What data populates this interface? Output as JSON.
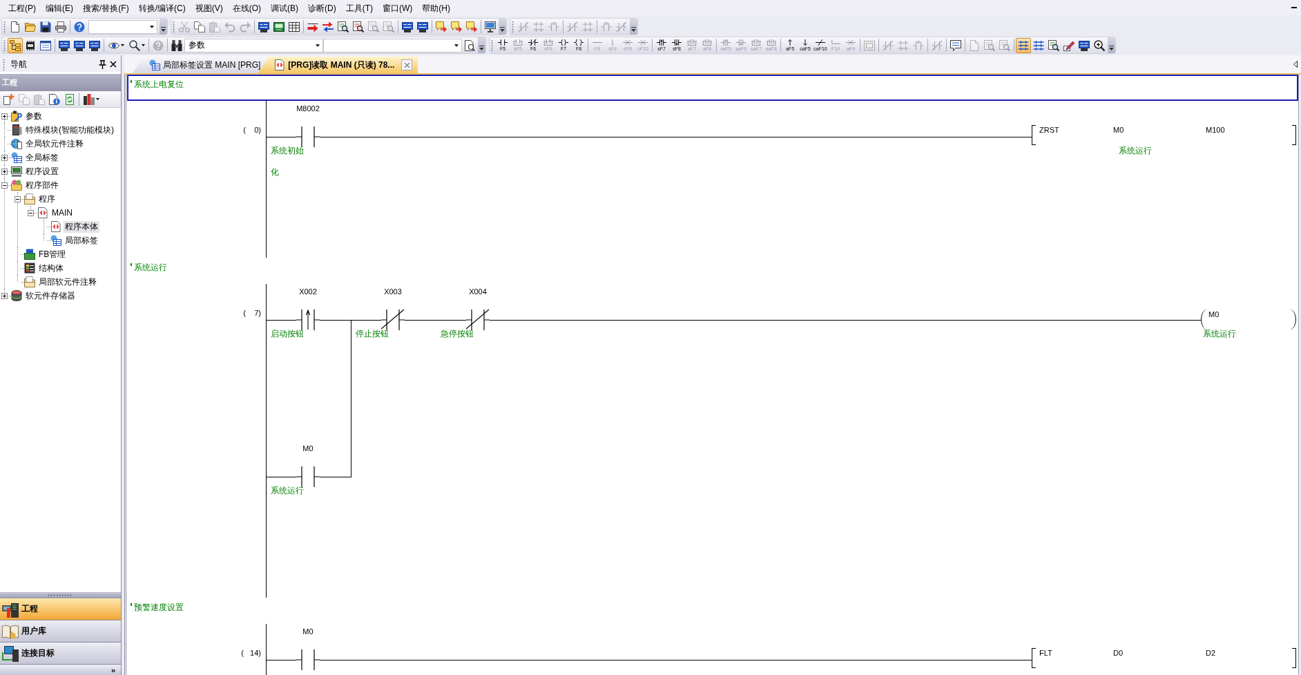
{
  "menu_bar": {
    "items": [
      "工程(P)",
      "编辑(E)",
      "搜索/替换(F)",
      "转换/编译(C)",
      "视图(V)",
      "在线(O)",
      "调试(B)",
      "诊断(D)",
      "工具(T)",
      "窗口(W)",
      "帮助(H)"
    ]
  },
  "toolbar_rows": [
    [
      {
        "items": [
          {
            "kind": "button",
            "disabled": false,
            "on": false
          },
          {
            "kind": "button",
            "disabled": false,
            "on": false
          },
          {
            "kind": "button",
            "disabled": false,
            "on": false
          },
          {
            "kind": "button",
            "disabled": false,
            "on": false
          },
          {
            "kind": "separator"
          },
          {
            "kind": "button",
            "disabled": false,
            "on": false
          },
          {
            "kind": "combo"
          }
        ]
      },
      {
        "items": [
          {
            "kind": "button",
            "disabled": true,
            "on": false
          },
          {
            "kind": "button",
            "disabled": false,
            "on": false
          },
          {
            "kind": "button",
            "disabled": true,
            "on": false
          },
          {
            "kind": "button",
            "disabled": true,
            "on": false
          },
          {
            "kind": "button",
            "disabled": true,
            "on": false
          },
          {
            "kind": "separator"
          },
          {
            "kind": "button",
            "disabled": false,
            "on": false
          },
          {
            "kind": "button",
            "disabled": false,
            "on": false
          },
          {
            "kind": "button",
            "disabled": false,
            "on": false
          },
          {
            "kind": "separator"
          },
          {
            "kind": "button",
            "disabled": false,
            "on": false
          },
          {
            "kind": "button",
            "disabled": false,
            "on": false
          },
          {
            "kind": "button",
            "disabled": false,
            "on": false
          },
          {
            "kind": "button",
            "disabled": false,
            "on": false
          },
          {
            "kind": "button",
            "disabled": true,
            "on": false
          },
          {
            "kind": "button",
            "disabled": true,
            "on": false
          },
          {
            "kind": "separator"
          },
          {
            "kind": "button",
            "disabled": false,
            "on": false
          },
          {
            "kind": "button",
            "disabled": false,
            "on": false
          },
          {
            "kind": "separator"
          },
          {
            "kind": "button",
            "disabled": false,
            "on": false
          },
          {
            "kind": "button",
            "disabled": false,
            "on": false
          },
          {
            "kind": "button",
            "disabled": false,
            "on": false
          },
          {
            "kind": "separator"
          },
          {
            "kind": "button",
            "disabled": false,
            "on": false
          }
        ]
      },
      {
        "items": [
          {
            "kind": "button",
            "disabled": true,
            "on": false
          },
          {
            "kind": "button",
            "disabled": true,
            "on": false
          },
          {
            "kind": "button",
            "disabled": true,
            "on": false
          },
          {
            "kind": "separator"
          },
          {
            "kind": "button",
            "disabled": true,
            "on": false
          },
          {
            "kind": "button",
            "disabled": true,
            "on": false
          },
          {
            "kind": "separator"
          },
          {
            "kind": "button",
            "disabled": true,
            "on": false
          },
          {
            "kind": "button",
            "disabled": true,
            "on": false
          }
        ]
      }
    ],
    [
      {
        "items": [
          {
            "kind": "button",
            "disabled": false,
            "on": true
          },
          {
            "kind": "button",
            "disabled": false,
            "on": false
          },
          {
            "kind": "button",
            "disabled": false,
            "on": false
          },
          {
            "kind": "separator"
          },
          {
            "kind": "button",
            "disabled": false,
            "on": false
          },
          {
            "kind": "button",
            "disabled": false,
            "on": false
          },
          {
            "kind": "button",
            "disabled": false,
            "on": false
          },
          {
            "kind": "separator"
          },
          {
            "kind": "menu-button",
            "disabled": false,
            "on": false
          },
          {
            "kind": "menu-button",
            "disabled": false,
            "on": false
          },
          {
            "kind": "separator"
          },
          {
            "kind": "button",
            "disabled": true,
            "on": false
          },
          {
            "kind": "separator"
          },
          {
            "kind": "button",
            "disabled": false,
            "on": false
          },
          {
            "kind": "combo",
            "value": "参数"
          },
          {
            "kind": "combo"
          },
          {
            "kind": "button",
            "disabled": false,
            "on": false
          }
        ]
      },
      {
        "items": [
          {
            "kind": "fkey",
            "label": "F5",
            "disabled": false,
            "on": false
          },
          {
            "kind": "fkey",
            "label": "sF5",
            "disabled": true,
            "on": false
          },
          {
            "kind": "fkey",
            "label": "F6",
            "disabled": false,
            "on": false
          },
          {
            "kind": "fkey",
            "label": "sF6",
            "disabled": true,
            "on": false
          },
          {
            "kind": "fkey",
            "label": "F7",
            "disabled": false,
            "on": false
          },
          {
            "kind": "fkey",
            "label": "F8",
            "disabled": false,
            "on": false
          },
          {
            "kind": "separator"
          },
          {
            "kind": "fkey",
            "label": "F9",
            "disabled": true,
            "on": false
          },
          {
            "kind": "fkey",
            "label": "sF9",
            "disabled": true,
            "on": false
          },
          {
            "kind": "fkey",
            "label": "cF9",
            "disabled": true,
            "on": false
          },
          {
            "kind": "fkey",
            "label": "cF10",
            "disabled": true,
            "on": false
          },
          {
            "kind": "separator"
          },
          {
            "kind": "fkey",
            "label": "sF7",
            "disabled": false,
            "on": false
          },
          {
            "kind": "fkey",
            "label": "sF8",
            "disabled": false,
            "on": false
          },
          {
            "kind": "fkey",
            "label": "aF7",
            "disabled": true,
            "on": false
          },
          {
            "kind": "fkey",
            "label": "aF8",
            "disabled": true,
            "on": false
          },
          {
            "kind": "separator"
          },
          {
            "kind": "fkey",
            "label": "saF5",
            "disabled": true,
            "on": false
          },
          {
            "kind": "fkey",
            "label": "saF6",
            "disabled": true,
            "on": false
          },
          {
            "kind": "fkey",
            "label": "saF7",
            "disabled": true,
            "on": false
          },
          {
            "kind": "fkey",
            "label": "saF8",
            "disabled": true,
            "on": false
          },
          {
            "kind": "separator"
          },
          {
            "kind": "fkey",
            "label": "aF5",
            "disabled": false,
            "on": false
          },
          {
            "kind": "fkey",
            "label": "caF5",
            "disabled": false,
            "on": false
          },
          {
            "kind": "fkey",
            "label": "caF10",
            "disabled": false,
            "on": false
          },
          {
            "kind": "fkey",
            "label": "F10",
            "disabled": true,
            "on": false
          },
          {
            "kind": "fkey",
            "label": "aF9",
            "disabled": true,
            "on": false
          },
          {
            "kind": "separator"
          },
          {
            "kind": "button",
            "disabled": true,
            "on": false
          },
          {
            "kind": "separator"
          },
          {
            "kind": "button",
            "disabled": true,
            "on": false
          },
          {
            "kind": "button",
            "disabled": true,
            "on": false
          },
          {
            "kind": "button",
            "disabled": true,
            "on": false
          },
          {
            "kind": "separator"
          },
          {
            "kind": "button",
            "disabled": true,
            "on": false
          },
          {
            "kind": "separator"
          },
          {
            "kind": "button",
            "disabled": false,
            "on": false
          },
          {
            "kind": "separator"
          },
          {
            "kind": "button",
            "disabled": true,
            "on": false
          },
          {
            "kind": "button",
            "disabled": true,
            "on": false
          },
          {
            "kind": "button",
            "disabled": true,
            "on": false
          },
          {
            "kind": "separator"
          },
          {
            "kind": "button",
            "disabled": false,
            "on": true
          },
          {
            "kind": "button",
            "disabled": false,
            "on": false
          },
          {
            "kind": "button",
            "disabled": false,
            "on": false
          },
          {
            "kind": "button",
            "disabled": false,
            "on": false
          },
          {
            "kind": "button",
            "disabled": false,
            "on": false
          },
          {
            "kind": "button",
            "disabled": false,
            "on": false
          }
        ]
      }
    ]
  ],
  "navigation": {
    "caption": "导航",
    "section": "工程",
    "toolbar": [
      {
        "kind": "button",
        "disabled": false,
        "on": false
      },
      {
        "kind": "button",
        "disabled": true,
        "on": false
      },
      {
        "kind": "button",
        "disabled": true,
        "on": false
      },
      {
        "kind": "button",
        "disabled": false,
        "on": false
      },
      {
        "kind": "button",
        "disabled": false,
        "on": false
      },
      {
        "kind": "separator"
      },
      {
        "kind": "menu-button",
        "disabled": false,
        "on": false
      }
    ],
    "tree": [
      {
        "label": "参数",
        "expanded": false,
        "selected": false
      },
      {
        "label": "特殊模块(智能功能模块)",
        "selected": false
      },
      {
        "label": "全局软元件注释",
        "selected": false
      },
      {
        "label": "全局标签",
        "expanded": false,
        "selected": false
      },
      {
        "label": "程序设置",
        "expanded": false,
        "selected": false
      },
      {
        "label": "程序部件",
        "expanded": true,
        "selected": false,
        "children": [
          {
            "label": "程序",
            "expanded": true,
            "selected": false,
            "children": [
              {
                "label": "MAIN",
                "expanded": true,
                "selected": false,
                "children": [
                  {
                    "label": "程序本体",
                    "selected": true
                  },
                  {
                    "label": "局部标签",
                    "selected": false
                  }
                ]
              }
            ]
          },
          {
            "label": "FB管理",
            "selected": false
          },
          {
            "label": "结构体",
            "selected": false
          },
          {
            "label": "局部软元件注释",
            "selected": false
          }
        ]
      },
      {
        "label": "软元件存储器",
        "expanded": false,
        "selected": false
      }
    ],
    "buttons": [
      {
        "label": "工程",
        "selected": true
      },
      {
        "label": "用户库",
        "selected": false
      },
      {
        "label": "连接目标",
        "selected": false
      }
    ],
    "more": "»"
  },
  "tabs": [
    {
      "label": "局部标签设置 MAIN [PRG]",
      "selected": false,
      "closable": false
    },
    {
      "label": "[PRG]读取 MAIN (只读) 78...",
      "selected": true,
      "closable": true
    }
  ],
  "ladder": {
    "rungs": [
      {
        "statement": "系统上电复位",
        "selected": true,
        "step": "(    0)",
        "contacts": [
          {
            "kind": "open",
            "device": "M8002",
            "comment": "系统初始化"
          }
        ],
        "output": {
          "kind": "instruction",
          "name": "ZRST",
          "operands": [
            {
              "device": "M0",
              "comment": "系统运行"
            },
            {
              "device": "M100"
            }
          ]
        }
      },
      {
        "statement": "系统运行",
        "selected": false,
        "step": "(    7)",
        "contacts": [
          {
            "kind": "rising",
            "device": "X002",
            "comment": "启动按钮"
          },
          {
            "kind": "closed",
            "device": "X003",
            "comment": "停止按钮"
          },
          {
            "kind": "closed",
            "device": "X004",
            "comment": "急停按钮"
          }
        ],
        "branches": [
          {
            "contacts": [
              {
                "kind": "open",
                "device": "M0",
                "comment": "系统运行"
              }
            ]
          }
        ],
        "output": {
          "kind": "coil",
          "device": "M0",
          "comment": "系统运行"
        }
      },
      {
        "statement": "预警速度设置",
        "selected": false,
        "step": "(   14)",
        "contacts": [
          {
            "kind": "open",
            "device": "M0"
          }
        ],
        "output": {
          "kind": "instruction",
          "name": "FLT",
          "operands": [
            {
              "device": "D0"
            },
            {
              "device": "D2"
            }
          ]
        }
      }
    ]
  }
}
